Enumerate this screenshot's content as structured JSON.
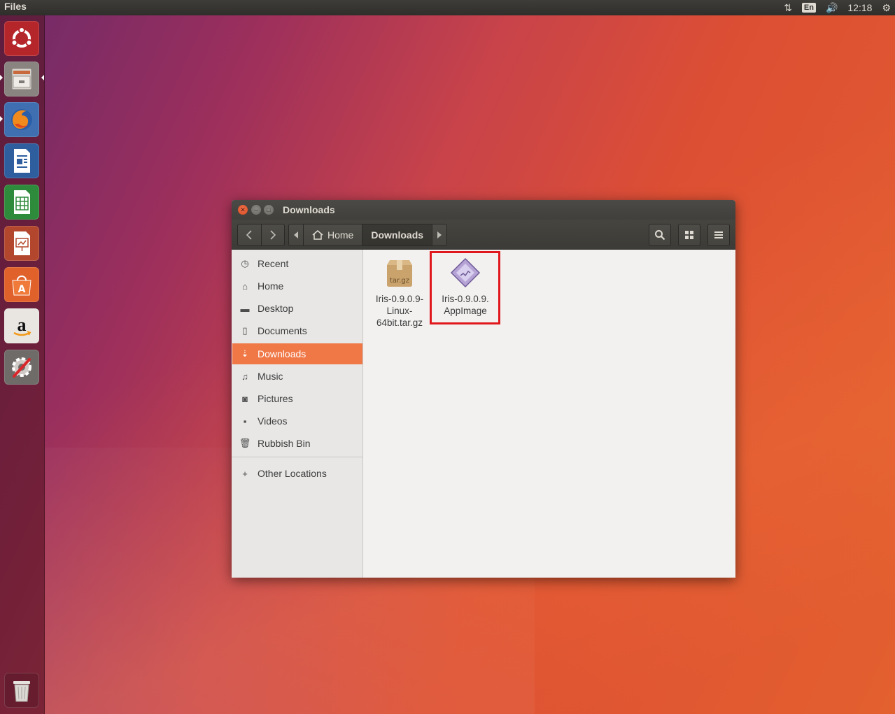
{
  "topbar": {
    "app_name": "Files",
    "lang": "En",
    "clock": "12:18"
  },
  "launcher": {
    "items": [
      {
        "name": "Ubuntu Dash"
      },
      {
        "name": "Files"
      },
      {
        "name": "Firefox"
      },
      {
        "name": "LibreOffice Writer"
      },
      {
        "name": "LibreOffice Calc"
      },
      {
        "name": "LibreOffice Impress"
      },
      {
        "name": "Ubuntu Software"
      },
      {
        "name": "Amazon"
      },
      {
        "name": "System Settings"
      },
      {
        "name": "Trash"
      }
    ]
  },
  "window": {
    "title": "Downloads",
    "path": {
      "home_label": "Home",
      "current_label": "Downloads"
    },
    "sidebar": {
      "items": [
        {
          "label": "Recent",
          "icon": "clock-icon"
        },
        {
          "label": "Home",
          "icon": "home-icon"
        },
        {
          "label": "Desktop",
          "icon": "folder-icon"
        },
        {
          "label": "Documents",
          "icon": "document-icon"
        },
        {
          "label": "Downloads",
          "icon": "download-icon",
          "active": true
        },
        {
          "label": "Music",
          "icon": "music-icon"
        },
        {
          "label": "Pictures",
          "icon": "camera-icon"
        },
        {
          "label": "Videos",
          "icon": "video-icon"
        },
        {
          "label": "Rubbish Bin",
          "icon": "trash-icon"
        }
      ],
      "other_locations": "Other Locations"
    },
    "files": [
      {
        "line1": "Iris-0.9.0.9-",
        "line2": "Linux-",
        "line3": "64bit.tar.gz",
        "icon_label": "tar.gz"
      },
      {
        "line1": "Iris-0.9.0.9.",
        "line2": "AppImage"
      }
    ]
  },
  "colors": {
    "accent": "#f07746",
    "highlight": "#e0181e"
  }
}
